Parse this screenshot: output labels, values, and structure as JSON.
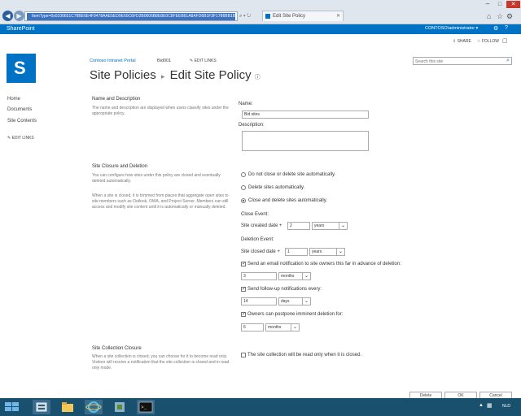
{
  "browser": {
    "address_url": "ItemType=0x0100651C78BE6E4F9478AAE5ED9E60C6FD2B0606B8E8E0C8FEEB61A8AFD6B1F3F1786BB1BF4",
    "tabs": [
      {
        "label": "Edit Site Policy"
      }
    ],
    "icons": {
      "back": "back-icon",
      "forward": "forward-icon",
      "home": "home-icon",
      "favorites": "star-icon",
      "settings": "gear-icon"
    }
  },
  "suite": {
    "brand": "SharePoint",
    "user": "CONTOSO\\administrator ▾",
    "actions": {
      "share": "SHARE",
      "follow": "FOLLOW"
    }
  },
  "header": {
    "breadcrumb": [
      "Contoso Intranet Portal",
      "Bid001"
    ],
    "edit_links": "EDIT LINKS",
    "title_main": "Site Policies",
    "title_sep": "▸",
    "title_sub": "Edit Site Policy",
    "search_placeholder": "Search this site"
  },
  "nav": {
    "items": [
      {
        "label": "Home"
      },
      {
        "label": "Documents"
      },
      {
        "label": "Site Contents"
      }
    ],
    "edit_links": "EDIT LINKS"
  },
  "name_section": {
    "title": "Name and Description",
    "description": "The name and description are displayed when users classify sites under the appropriate policy.",
    "name_label": "Name:",
    "name_value": "Bid sites",
    "description_label": "Description:",
    "description_value": ""
  },
  "closure_section": {
    "title": "Site Closure and Deletion",
    "description1": "You can configure how sites under this policy are closed and eventually deleted automatically.",
    "description2": "When a site is closed, it is trimmed from places that aggregate open sites to site members such as Outlook, OWA, and Project Server. Members can still access and modify site content until it is automatically or manually deleted.",
    "options": [
      {
        "label": "Do not close or delete site automatically.",
        "selected": false
      },
      {
        "label": "Delete sites automatically.",
        "selected": false
      },
      {
        "label": "Close and delete sites automatically.",
        "selected": true
      }
    ],
    "close_event_label": "Close Event:",
    "close_prefix": "Site created date +",
    "close_value": "2",
    "close_unit": "years",
    "deletion_event_label": "Deletion Event:",
    "delete_prefix": "Site closed date +",
    "delete_value": "1",
    "delete_unit": "years",
    "email_label": "Send an email notification to site owners this far in advance of deletion:",
    "email_checked": true,
    "email_value": "3",
    "email_unit": "months",
    "followup_label": "Send follow-up notifications every:",
    "followup_checked": true,
    "followup_value": "14",
    "followup_unit": "days",
    "postpone_label": "Owners can postpone imminent deletion for:",
    "postpone_checked": true,
    "postpone_value": "6",
    "postpone_unit": "months"
  },
  "collection_section": {
    "title": "Site Collection Closure",
    "description": "When a site collection is closed, you can choose for it to become read only. Visitors will receive a notification that the site collection is closed and in read only mode.",
    "readonly_label": "The site collection will be read only when it is closed.",
    "readonly_checked": false
  },
  "buttons": {
    "delete": "Delete",
    "ok": "OK",
    "cancel": "Cancel"
  },
  "taskbar": {
    "lang": "NLD"
  },
  "colors": {
    "accent": "#0072c6",
    "suite_bar": "#0072c6",
    "taskbar": "#19506e"
  }
}
